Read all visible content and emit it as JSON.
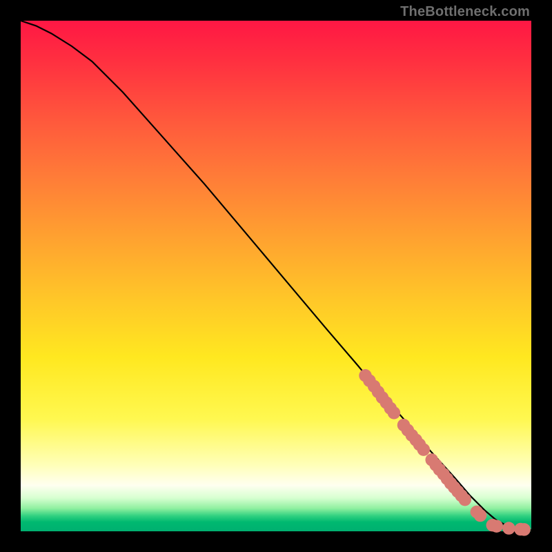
{
  "watermark": "TheBottleneck.com",
  "chart_data": {
    "type": "line",
    "title": "",
    "xlabel": "",
    "ylabel": "",
    "xlim": [
      0,
      100
    ],
    "ylim": [
      0,
      100
    ],
    "grid": false,
    "series": [
      {
        "name": "curve",
        "color": "#000000",
        "x": [
          0,
          3,
          6,
          10,
          14,
          20,
          28,
          36,
          44,
          52,
          60,
          66,
          71,
          75,
          80,
          85,
          88,
          91,
          93,
          95,
          97,
          99,
          100
        ],
        "y": [
          100,
          99,
          97.5,
          95,
          92,
          86,
          77,
          68,
          58.5,
          49,
          39.5,
          32.5,
          26.5,
          22,
          16,
          10.5,
          7,
          4,
          2.3,
          1.2,
          0.6,
          0.3,
          0.2
        ]
      }
    ],
    "markers": [
      {
        "name": "cluster-upper",
        "color": "#d87a72",
        "radius_pct": 1.25,
        "points": [
          [
            67.5,
            30.5
          ],
          [
            68.3,
            29.5
          ],
          [
            69.2,
            28.4
          ],
          [
            70.0,
            27.3
          ],
          [
            70.8,
            26.2
          ],
          [
            71.6,
            25.2
          ],
          [
            72.4,
            24.1
          ],
          [
            73.1,
            23.2
          ]
        ]
      },
      {
        "name": "cluster-mid",
        "color": "#d87a72",
        "radius_pct": 1.25,
        "points": [
          [
            75.0,
            20.8
          ],
          [
            75.8,
            19.8
          ],
          [
            76.6,
            18.8
          ],
          [
            77.4,
            17.9
          ],
          [
            78.1,
            17.0
          ],
          [
            78.9,
            16.0
          ]
        ]
      },
      {
        "name": "cluster-lower",
        "color": "#d87a72",
        "radius_pct": 1.25,
        "points": [
          [
            80.5,
            14.0
          ],
          [
            81.3,
            13.0
          ],
          [
            82.0,
            12.1
          ],
          [
            82.8,
            11.2
          ],
          [
            83.5,
            10.3
          ],
          [
            84.2,
            9.4
          ],
          [
            84.9,
            8.6
          ],
          [
            85.6,
            7.8
          ],
          [
            86.3,
            7.0
          ],
          [
            87.0,
            6.2
          ]
        ]
      },
      {
        "name": "knee",
        "color": "#d87a72",
        "radius_pct": 1.25,
        "points": [
          [
            89.3,
            3.8
          ],
          [
            90.0,
            3.1
          ]
        ]
      },
      {
        "name": "tail",
        "color": "#d87a72",
        "radius_pct": 1.25,
        "points": [
          [
            92.4,
            1.2
          ],
          [
            93.2,
            1.0
          ],
          [
            95.6,
            0.6
          ],
          [
            97.9,
            0.4
          ],
          [
            98.6,
            0.35
          ]
        ]
      }
    ]
  }
}
